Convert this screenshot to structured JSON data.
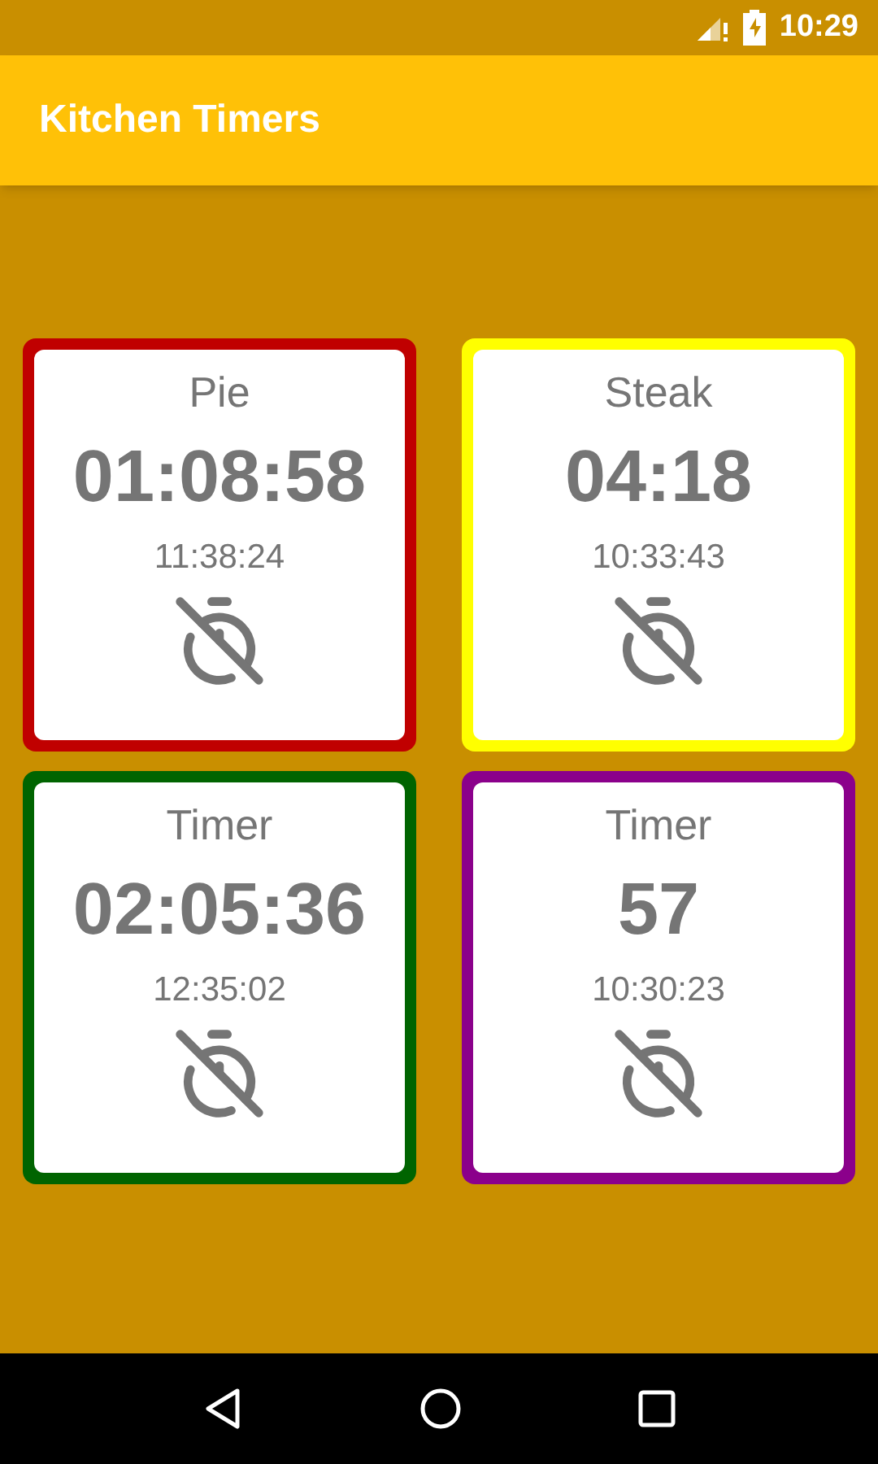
{
  "status_bar": {
    "time": "10:29"
  },
  "app_bar": {
    "title": "Kitchen Timers"
  },
  "timers": [
    {
      "name": "Pie",
      "remaining": "01:08:58",
      "ends_at": "11:38:24",
      "color": "#c00000"
    },
    {
      "name": "Steak",
      "remaining": "04:18",
      "ends_at": "10:33:43",
      "color": "#ffff00"
    },
    {
      "name": "Timer",
      "remaining": "02:05:36",
      "ends_at": "12:35:02",
      "color": "#006400"
    },
    {
      "name": "Timer",
      "remaining": "57",
      "ends_at": "10:30:23",
      "color": "#8b008b"
    }
  ]
}
